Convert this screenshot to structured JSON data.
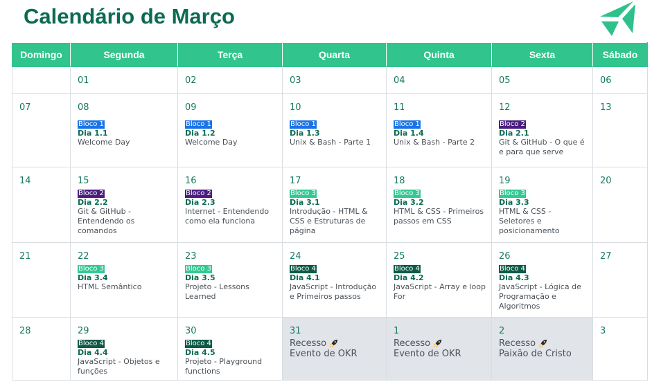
{
  "header": {
    "title": "Calendário de Março"
  },
  "weekdays": [
    "Domingo",
    "Segunda",
    "Terça",
    "Quarta",
    "Quinta",
    "Sexta",
    "Sábado"
  ],
  "weeks": [
    [
      {
        "num": ""
      },
      {
        "num": "01"
      },
      {
        "num": "02"
      },
      {
        "num": "03"
      },
      {
        "num": "04"
      },
      {
        "num": "05"
      },
      {
        "num": "06"
      }
    ],
    [
      {
        "num": "07"
      },
      {
        "num": "08",
        "bloco": "Bloco 1",
        "color": "blue",
        "dia": "Dia 1.1",
        "desc": "Welcome Day"
      },
      {
        "num": "09",
        "bloco": "Bloco 1",
        "color": "blue",
        "dia": "Dia 1.2",
        "desc": "Welcome Day"
      },
      {
        "num": "10",
        "bloco": "Bloco 1",
        "color": "blue",
        "dia": "Dia 1.3",
        "desc": "Unix & Bash - Parte 1"
      },
      {
        "num": "11",
        "bloco": "Bloco 1",
        "color": "blue",
        "dia": "Dia 1.4",
        "desc": "Unix & Bash - Parte 2"
      },
      {
        "num": "12",
        "bloco": "Bloco 2",
        "color": "purple",
        "dia": "Dia 2.1",
        "desc": "Git & GitHub - O que é e para que serve"
      },
      {
        "num": "13"
      }
    ],
    [
      {
        "num": "14"
      },
      {
        "num": "15",
        "bloco": "Bloco 2",
        "color": "purple",
        "dia": "Dia 2.2",
        "desc": "Git & GitHub - Entendendo os comandos"
      },
      {
        "num": "16",
        "bloco": "Bloco 2",
        "color": "purple",
        "dia": "Dia 2.3",
        "desc": "Internet - Entendendo como ela funciona"
      },
      {
        "num": "17",
        "bloco": "Bloco 3",
        "color": "green",
        "dia": "Dia 3.1",
        "desc": "Introdução - HTML & CSS e Estruturas de página"
      },
      {
        "num": "18",
        "bloco": "Bloco 3",
        "color": "green",
        "dia": "Dia 3.2",
        "desc": "HTML & CSS - Primeiros passos em CSS"
      },
      {
        "num": "19",
        "bloco": "Bloco 3",
        "color": "green",
        "dia": "Dia 3.3",
        "desc": "HTML & CSS - Seletores e posicionamento"
      },
      {
        "num": "20"
      }
    ],
    [
      {
        "num": "21"
      },
      {
        "num": "22",
        "bloco": "Bloco 3",
        "color": "green",
        "dia": "Dia 3.4",
        "desc": "HTML Semântico"
      },
      {
        "num": "23",
        "bloco": "Bloco 3",
        "color": "green",
        "dia": "Dia 3.5",
        "desc": "Projeto - Lessons Learned"
      },
      {
        "num": "24",
        "bloco": "Bloco 4",
        "color": "dark",
        "dia": "Dia 4.1",
        "desc": "JavaScript - Introdução e Primeiros passos"
      },
      {
        "num": "25",
        "bloco": "Bloco 4",
        "color": "dark",
        "dia": "Dia 4.2",
        "desc": "JavaScript - Array e loop For"
      },
      {
        "num": "26",
        "bloco": "Bloco 4",
        "color": "dark",
        "dia": "Dia 4.3",
        "desc": "JavaScript - Lógica de Programação e Algoritmos"
      },
      {
        "num": "27"
      }
    ],
    [
      {
        "num": "28"
      },
      {
        "num": "29",
        "bloco": "Bloco 4",
        "color": "dark",
        "dia": "Dia 4.4",
        "desc": "JavaScript - Objetos e funções"
      },
      {
        "num": "30",
        "bloco": "Bloco 4",
        "color": "dark",
        "dia": "Dia 4.5",
        "desc": "Projeto - Playground functions"
      },
      {
        "num": "31",
        "recesso": "Recesso",
        "evento": "Evento de OKR",
        "gray": true
      },
      {
        "num": "1",
        "recesso": "Recesso",
        "evento": "Evento de OKR",
        "gray": true
      },
      {
        "num": "2",
        "recesso": "Recesso",
        "evento": "Paixão de Cristo",
        "gray": true
      },
      {
        "num": "3"
      }
    ]
  ],
  "colors": {
    "header_bg": "#31c48d",
    "title": "#0b6b52",
    "blue": "#1a73e8",
    "purple": "#4a1d7e",
    "green": "#34c892",
    "dark": "#0e5a47",
    "gray_cell": "#e1e4e9"
  },
  "icons": {
    "logo": "trybe-logo-icon",
    "rocket": "rocket-icon"
  }
}
